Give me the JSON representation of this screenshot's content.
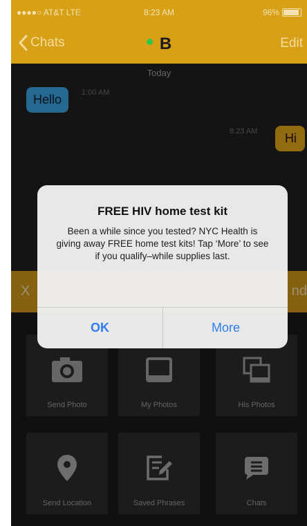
{
  "status_bar": {
    "carrier": "●●●●○ AT&T LTE",
    "time": "8:23 AM",
    "battery": "96%"
  },
  "nav": {
    "back_label": "Chats",
    "title": "B",
    "edit_label": "Edit"
  },
  "chat": {
    "day_label": "Today",
    "messages": [
      {
        "direction": "in",
        "text": "Hello",
        "time": "1:00 AM"
      },
      {
        "direction": "out",
        "text": "Hi",
        "time": "8:23 AM"
      }
    ]
  },
  "send_bar": {
    "close_label": "X",
    "send_label": "nd"
  },
  "tiles": [
    {
      "label": "Send Photo",
      "icon": "camera-icon"
    },
    {
      "label": "My Photos",
      "icon": "photo-frame-icon"
    },
    {
      "label": "His Photos",
      "icon": "stacked-photos-icon"
    },
    {
      "label": "Send Location",
      "icon": "location-pin-icon"
    },
    {
      "label": "Saved Phrases",
      "icon": "note-pencil-icon"
    },
    {
      "label": "Chats",
      "icon": "chat-bubble-icon"
    }
  ],
  "alert": {
    "title": "FREE HIV home test kit",
    "body": "Been a while since you tested? NYC Health is giving away FREE home test kits! Tap ‘More’ to see if you qualify–while supplies last.",
    "ok_label": "OK",
    "more_label": "More"
  },
  "colors": {
    "brand": "#d8a016",
    "incoming_bubble": "#3aa0dd",
    "outgoing_bubble": "#e2a518",
    "alert_button": "#2d7cf6"
  }
}
